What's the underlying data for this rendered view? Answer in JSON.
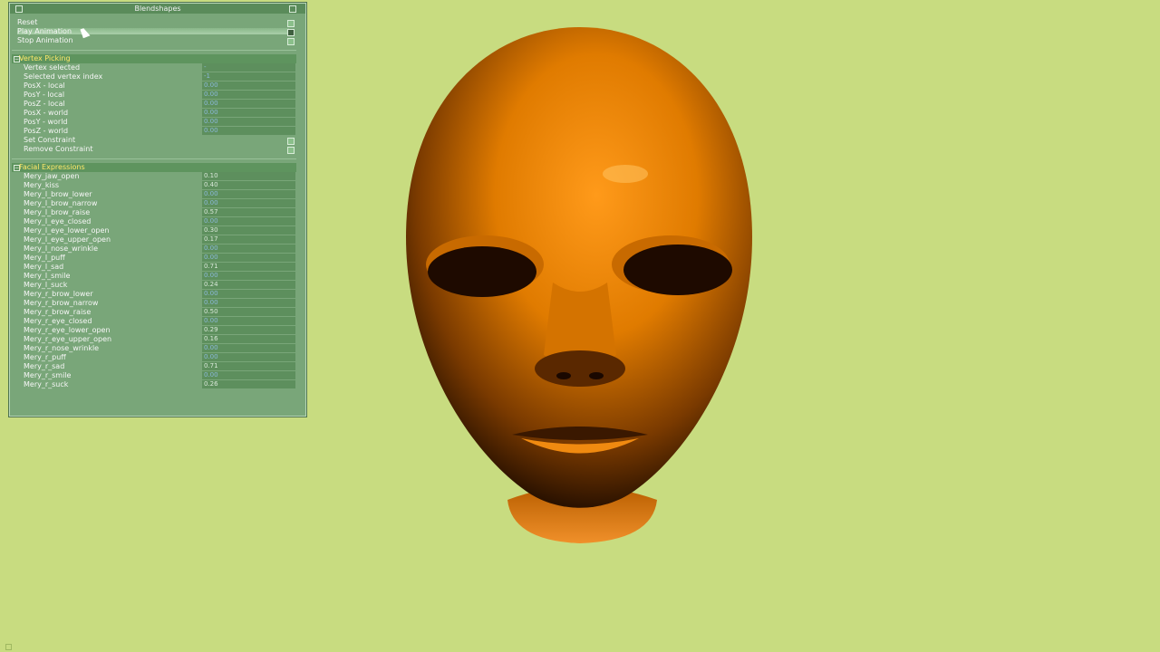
{
  "window": {
    "title": "Blendshapes"
  },
  "buttons": {
    "reset": "Reset",
    "play": "Play Animation",
    "stop": "Stop Animation"
  },
  "vertex_picking": {
    "title": "Vertex Picking",
    "rows": [
      {
        "label": "Vertex selected",
        "value": "-"
      },
      {
        "label": "Selected vertex index",
        "value": "-1"
      },
      {
        "label": "PosX - local",
        "value": "0.00"
      },
      {
        "label": "PosY - local",
        "value": "0.00"
      },
      {
        "label": "PosZ - local",
        "value": "0.00"
      },
      {
        "label": "PosX - world",
        "value": "0.00"
      },
      {
        "label": "PosY - world",
        "value": "0.00"
      },
      {
        "label": "PosZ - world",
        "value": "0.00"
      }
    ],
    "set_constraint": "Set Constraint",
    "remove_constraint": "Remove Constraint"
  },
  "facial_expressions": {
    "title": "Facial Expressions",
    "rows": [
      {
        "label": "Mery_jaw_open",
        "value": "0.10"
      },
      {
        "label": "Mery_kiss",
        "value": "0.40"
      },
      {
        "label": "Mery_l_brow_lower",
        "value": "0.00"
      },
      {
        "label": "Mery_l_brow_narrow",
        "value": "0.00"
      },
      {
        "label": "Mery_l_brow_raise",
        "value": "0.57"
      },
      {
        "label": "Mery_l_eye_closed",
        "value": "0.00"
      },
      {
        "label": "Mery_l_eye_lower_open",
        "value": "0.30"
      },
      {
        "label": "Mery_l_eye_upper_open",
        "value": "0.17"
      },
      {
        "label": "Mery_l_nose_wrinkle",
        "value": "0.00"
      },
      {
        "label": "Mery_l_puff",
        "value": "0.00"
      },
      {
        "label": "Mery_l_sad",
        "value": "0.71"
      },
      {
        "label": "Mery_l_smile",
        "value": "0.00"
      },
      {
        "label": "Mery_l_suck",
        "value": "0.24"
      },
      {
        "label": "Mery_r_brow_lower",
        "value": "0.00"
      },
      {
        "label": "Mery_r_brow_narrow",
        "value": "0.00"
      },
      {
        "label": "Mery_r_brow_raise",
        "value": "0.50"
      },
      {
        "label": "Mery_r_eye_closed",
        "value": "0.00"
      },
      {
        "label": "Mery_r_eye_lower_open",
        "value": "0.29"
      },
      {
        "label": "Mery_r_eye_upper_open",
        "value": "0.16"
      },
      {
        "label": "Mery_r_nose_wrinkle",
        "value": "0.00"
      },
      {
        "label": "Mery_r_puff",
        "value": "0.00"
      },
      {
        "label": "Mery_r_sad",
        "value": "0.71"
      },
      {
        "label": "Mery_r_smile",
        "value": "0.00"
      },
      {
        "label": "Mery_r_suck",
        "value": "0.26"
      }
    ]
  },
  "colors": {
    "background": "#c8dc80",
    "panel": "#79a679",
    "section_title": "#ffe86a",
    "head": "#e07b00"
  }
}
